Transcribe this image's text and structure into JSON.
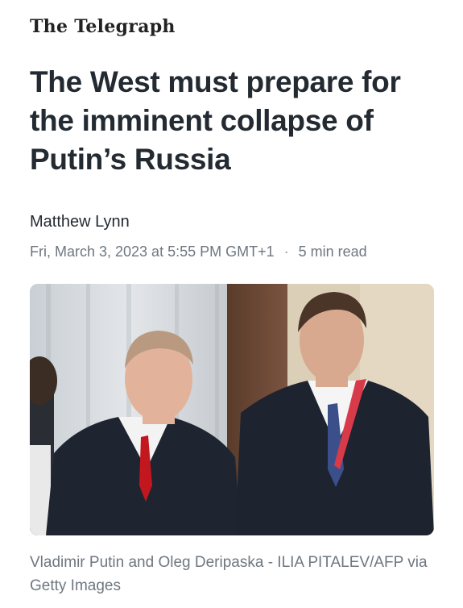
{
  "publisher": {
    "name": "The Telegraph"
  },
  "article": {
    "headline": "The West must prepare for the imminent collapse of Putin’s Russia",
    "author": "Matthew Lynn",
    "date": "Fri, March 3, 2023 at 5:55 PM GMT+1",
    "separator": "·",
    "read_time": "5 min read"
  },
  "photo": {
    "caption": "Vladimir Putin and Oleg Deripaska - ILIA PITALEV/AFP via Getty Images"
  }
}
